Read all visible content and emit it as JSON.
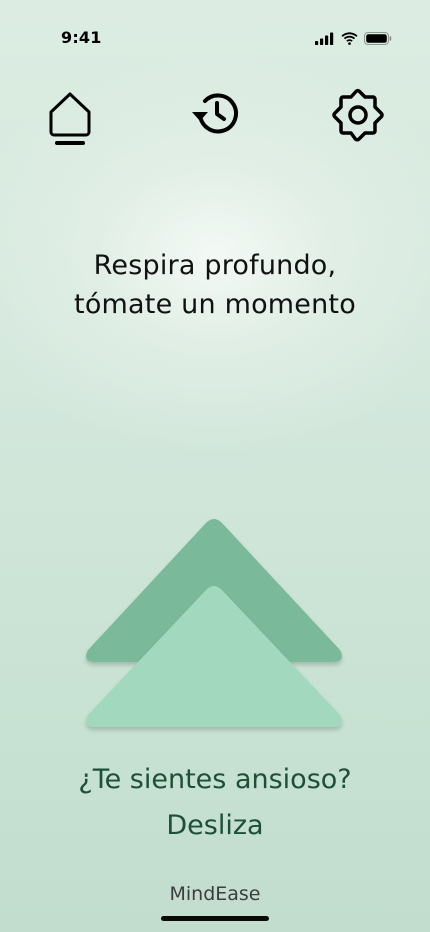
{
  "status_bar": {
    "time": "9:41",
    "icons": [
      "cellular-signal-icon",
      "wifi-icon",
      "battery-icon"
    ]
  },
  "nav": {
    "items": [
      {
        "name": "home",
        "icon": "home-icon",
        "active": true
      },
      {
        "name": "history",
        "icon": "history-icon",
        "active": false
      },
      {
        "name": "settings",
        "icon": "gear-icon",
        "active": false
      }
    ]
  },
  "headline": {
    "line1": "Respira profundo,",
    "line2": "tómate un momento"
  },
  "prompt": {
    "line1": "¿Te sientes ansioso?",
    "line2": "Desliza"
  },
  "brand": {
    "name": "MindEase"
  },
  "colors": {
    "background": "#d4e8dc",
    "arrow_back": "#7ab99a",
    "arrow_front": "#a2d8bd",
    "prompt_text": "#1d5036"
  }
}
